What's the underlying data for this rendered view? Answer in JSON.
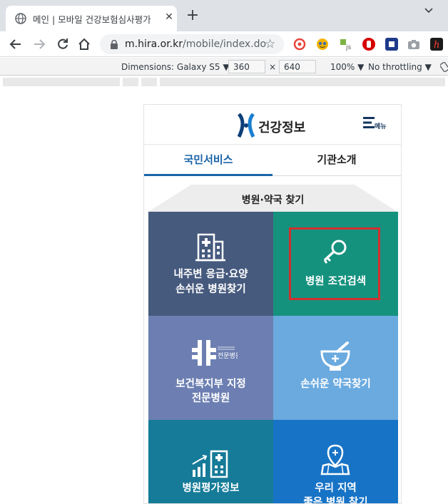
{
  "browser": {
    "tab_title": "메인 | 모바일 건강보험심사평가",
    "tab_close": "✕",
    "new_tab": "+",
    "url_host": "m.hira.or.kr",
    "url_path": "/mobile/index.do",
    "bookmark_star": "☆"
  },
  "devtools": {
    "dimensions_label": "Dimensions: Galaxy S5 ▼",
    "width": "360",
    "times": "×",
    "height": "640",
    "zoom": "100% ▼",
    "throttle": "No throttling ▼"
  },
  "site": {
    "logo_text": "건강정보",
    "menu_label": "메뉴",
    "tabs": [
      {
        "label": "국민서비스",
        "active": true
      },
      {
        "label": "기관소개",
        "active": false
      }
    ],
    "section_title": "병원·약국 찾기",
    "tiles": [
      {
        "line1": "내주변 응급·요양",
        "line2": "손쉬운 병원찾기",
        "color": "#465a7e",
        "icon": "hospital-building-icon"
      },
      {
        "line1": "병원 조건검색",
        "line2": "",
        "color": "#15927e",
        "icon": "key-search-icon",
        "highlighted": true
      },
      {
        "line1": "보건복지부 지정",
        "line2": "전문병원",
        "color": "#6d7fb2",
        "icon": "specialty-hospital-icon",
        "badge": "전문병원"
      },
      {
        "line1": "손쉬운 약국찾기",
        "line2": "",
        "color": "#6aaadf",
        "icon": "mortar-pestle-icon"
      },
      {
        "line1": "병원평가정보",
        "line2": "",
        "color": "#157b98",
        "icon": "evaluation-chart-icon"
      },
      {
        "line1": "우리 지역",
        "line2": "좋은 병원 찾기",
        "color": "#1773c6",
        "icon": "map-pin-icon"
      }
    ]
  },
  "colors": {
    "accent_blue": "#1a64a8",
    "highlight_red": "#d32f2f"
  }
}
